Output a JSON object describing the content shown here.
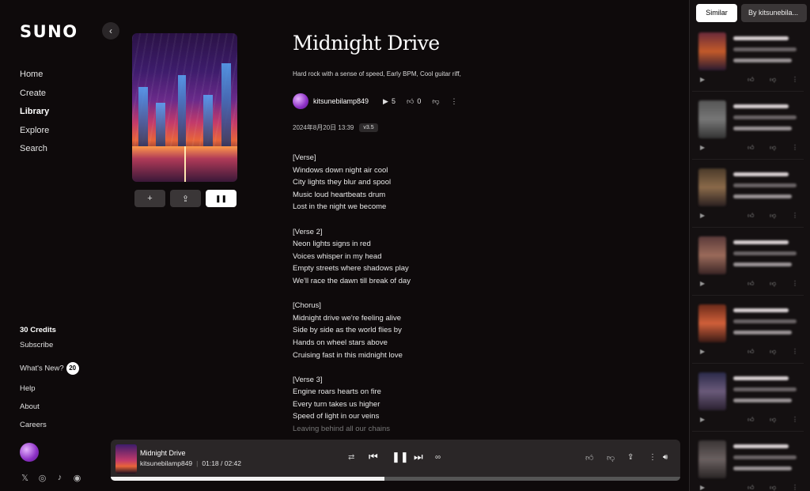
{
  "app": {
    "logo": "SUNO"
  },
  "nav": [
    {
      "label": "Home",
      "active": false
    },
    {
      "label": "Create",
      "active": false
    },
    {
      "label": "Library",
      "active": true
    },
    {
      "label": "Explore",
      "active": false
    },
    {
      "label": "Search",
      "active": false
    }
  ],
  "sidebar": {
    "credits": "30 Credits",
    "subscribe": "Subscribe",
    "whats_new": "What's New?",
    "whats_new_count": "20",
    "help": "Help",
    "about": "About",
    "careers": "Careers"
  },
  "song": {
    "title": "Midnight Drive",
    "tags": "Hard rock with a sense of speed, Early BPM, Cool guitar riff,",
    "author": "kitsunebilamp849",
    "plays": "5",
    "likes": "0",
    "date": "2024年8月20日 13:39",
    "version": "v3.5"
  },
  "lyrics": [
    "[Verse]",
    "Windows down night air cool",
    "City lights they blur and spool",
    "Music loud heartbeats drum",
    "Lost in the night we become",
    "",
    "[Verse 2]",
    "Neon lights signs in red",
    "Voices whisper in my head",
    "Empty streets where shadows play",
    "We'll race the dawn till break of day",
    "",
    "[Chorus]",
    "Midnight drive we're feeling alive",
    "Side by side as the world flies by",
    "Hands on wheel stars above",
    "Cruising fast in this midnight love",
    "",
    "[Verse 3]",
    "Engine roars hearts on fire",
    "Every turn takes us higher",
    "Speed of light in our veins",
    "Leaving behind all our chains"
  ],
  "player": {
    "title": "Midnight Drive",
    "author": "kitsunebilamp849",
    "time": "01:18 / 02:42",
    "progress": 0.48
  },
  "right_panel": {
    "tab_similar": "Similar",
    "tab_by": "By kitsunebila..."
  },
  "colors": {
    "background": "#0e0a0b",
    "panel": "#141011",
    "player": "#2a2627"
  }
}
